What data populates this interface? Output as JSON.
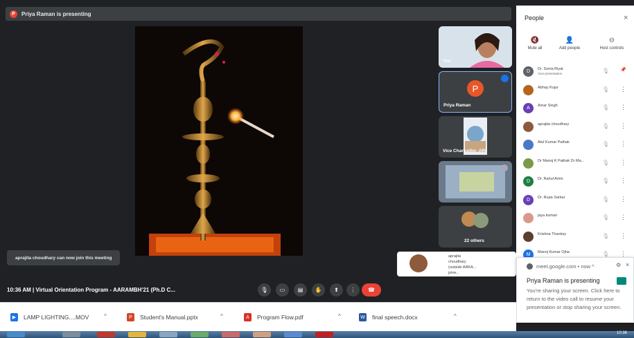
{
  "presenter_bar": {
    "initial": "P",
    "text": "Priya Raman is presenting"
  },
  "tiles": [
    {
      "label": "You"
    },
    {
      "initial": "P",
      "label": "Priya Raman"
    },
    {
      "label": "Vice Chancellor, ARI"
    },
    {
      "label": ""
    },
    {
      "label": "22 others"
    }
  ],
  "toast_join": "aprajita choudhary can now join this meeting",
  "join_request": {
    "text": "aprajita choudhary (outside ARKA... joine..."
  },
  "bottom_bar": {
    "meeting_info": "10:36 AM  |  Virtual Orientation Program - AARAMBH'21 (Ph.D C..."
  },
  "people_panel": {
    "title": "People",
    "close": "×",
    "actions": [
      {
        "label": "Mute all",
        "icon": "mute-all-icon"
      },
      {
        "label": "Add people",
        "icon": "add-people-icon"
      },
      {
        "label": "Host controls",
        "icon": "host-controls-icon"
      }
    ],
    "participants": [
      {
        "initial": "D",
        "name": "Dr. Sonia Riyat",
        "sub": "Your presentation",
        "color": "#5f6368"
      },
      {
        "initial": "",
        "name": "Abhay Kujur",
        "sub": "",
        "color": "#b5651d"
      },
      {
        "initial": "A",
        "name": "Amar Singh",
        "sub": "",
        "color": "#6a3fb5"
      },
      {
        "initial": "",
        "name": "aprajita choudhary",
        "sub": "",
        "color": "#8d5a3c"
      },
      {
        "initial": "",
        "name": "Atul Kumar Pathak",
        "sub": "",
        "color": "#4a79c9"
      },
      {
        "initial": "",
        "name": "Dr Manoj K Pathak Dr Ma...",
        "sub": "",
        "color": "#7c9a4a"
      },
      {
        "initial": "D",
        "name": "Dr. Rahul Amin",
        "sub": "",
        "color": "#1e7e45"
      },
      {
        "initial": "D",
        "name": "Dr. Rupa Sarkar",
        "sub": "",
        "color": "#6a3fb5"
      },
      {
        "initial": "",
        "name": "jaya kumari",
        "sub": "",
        "color": "#d99a8a"
      },
      {
        "initial": "",
        "name": "Krishna Thankey",
        "sub": "",
        "color": "#5a4030"
      },
      {
        "initial": "M",
        "name": "Manoj Kumar Ojha",
        "sub": "",
        "color": "#1a73e8"
      }
    ]
  },
  "notification": {
    "source": "meet.google.com  •  now ^",
    "title": "Priya Raman is presenting",
    "body": "You're sharing your screen. Click here to return to the video call to resume your presentation or stop sharing your screen."
  },
  "downloads": [
    {
      "name": "LAMP LIGHTING....MOV",
      "color": "#1a73e8"
    },
    {
      "name": "Student's Manual.pptx",
      "color": "#d24726"
    },
    {
      "name": "Program Flow.pdf",
      "color": "#d93025"
    },
    {
      "name": "final speech.docx",
      "color": "#2b579a"
    }
  ],
  "taskbar": {
    "clock": "10:36"
  }
}
